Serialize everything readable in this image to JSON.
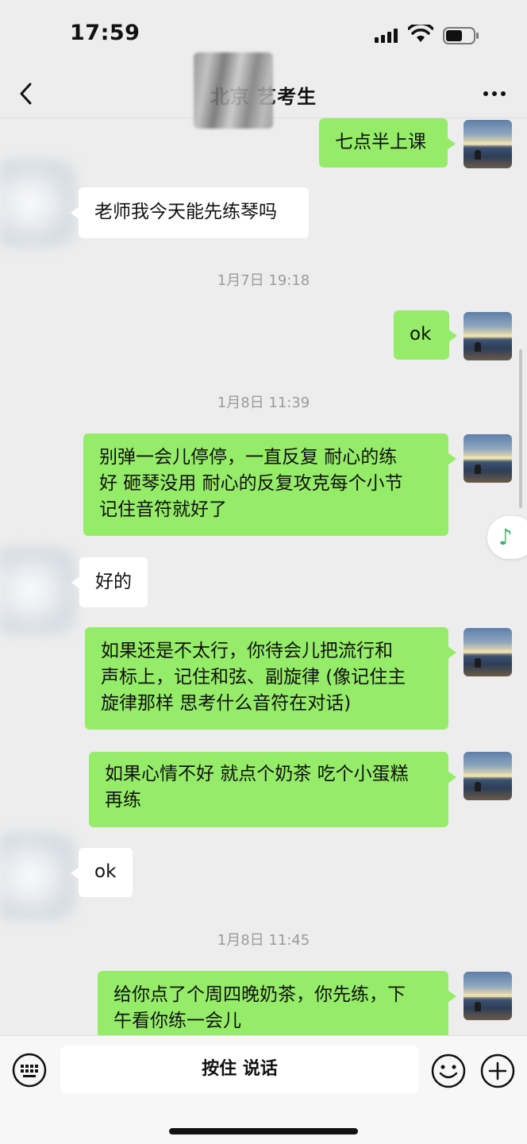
{
  "status_bar": {
    "time": "17:59"
  },
  "header": {
    "title": "北京 艺考生"
  },
  "messages": [
    {
      "side": "right",
      "lines": [
        "七点半上课"
      ]
    },
    {
      "side": "left",
      "lines": [
        "老师我今天能先练琴吗"
      ]
    },
    {
      "type": "timestamp",
      "text": "1月7日 19:18"
    },
    {
      "side": "right",
      "lines": [
        "ok"
      ]
    },
    {
      "type": "timestamp",
      "text": "1月8日 11:39"
    },
    {
      "side": "right",
      "lines": [
        "别弹一会儿停停，一直反复 耐心的练",
        "好 砸琴没用 耐心的反复攻克每个小节",
        "记住音符就好了"
      ]
    },
    {
      "side": "left",
      "lines": [
        "好的"
      ]
    },
    {
      "side": "right",
      "lines": [
        "如果还是不太行，你待会儿把流行和",
        "声标上，记住和弦、副旋律 (像记住主",
        "旋律那样 思考什么音符在对话)"
      ]
    },
    {
      "side": "right",
      "lines": [
        "如果心情不好 就点个奶茶 吃个小蛋糕",
        "再练"
      ]
    },
    {
      "side": "left",
      "lines": [
        "ok"
      ]
    },
    {
      "type": "timestamp",
      "text": "1月8日 11:45"
    },
    {
      "side": "right",
      "lines": [
        "给你点了个周四晚奶茶，你先练，下",
        "午看你练一会儿"
      ]
    }
  ],
  "input_bar": {
    "hold_to_talk": "按住 说话"
  },
  "icons": {
    "back": "chevron-left-icon",
    "more": "more-dots-icon",
    "music": "music-note-icon",
    "keyboard": "keyboard-icon",
    "emoji": "emoji-icon",
    "plus": "plus-icon"
  },
  "colors": {
    "bubble_self": "#95ec69",
    "bubble_other": "#ffffff",
    "background": "#ededed"
  }
}
